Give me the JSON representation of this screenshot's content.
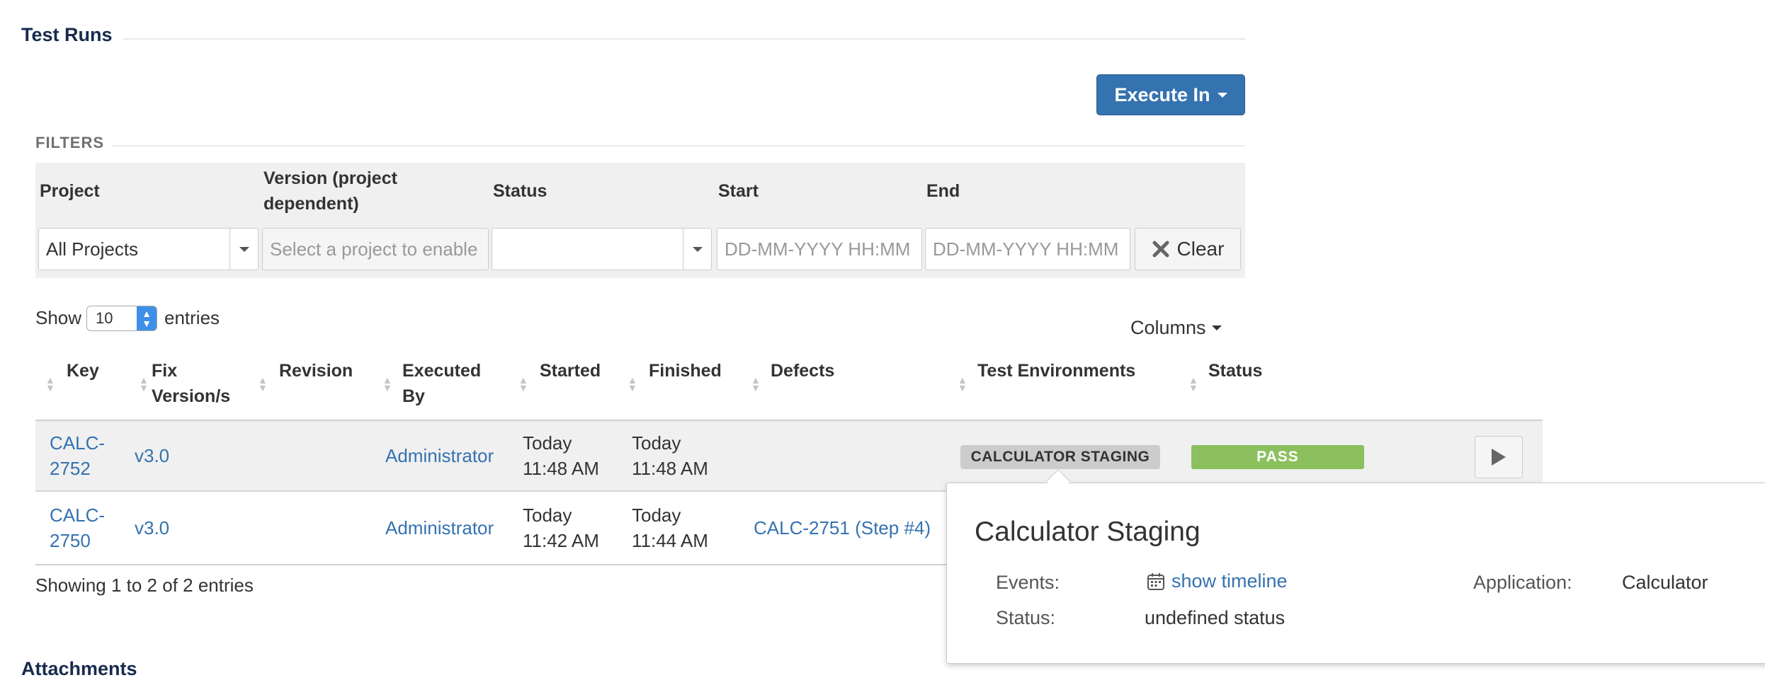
{
  "section": {
    "title": "Test Runs",
    "footer_section_title": "Attachments"
  },
  "toolbar": {
    "execute_label": "Execute In"
  },
  "filters": {
    "label": "FILTERS",
    "project_label": "Project",
    "version_label_line1": "Version (project",
    "version_label_line2": "dependent)",
    "status_label": "Status",
    "start_label": "Start",
    "end_label": "End",
    "project_value": "All Projects",
    "version_placeholder": "Select a project to enable",
    "status_value": "",
    "start_placeholder": "DD-MM-YYYY HH:MM",
    "end_placeholder": "DD-MM-YYYY HH:MM",
    "clear_label": "Clear"
  },
  "entries": {
    "show_label": "Show",
    "value": "10",
    "entries_label": "entries"
  },
  "columns_label": "Columns",
  "table": {
    "headers": {
      "key": "Key",
      "fix_versions_line1": "Fix",
      "fix_versions_line2": "Version/s",
      "revision": "Revision",
      "executed_by_line1": "Executed",
      "executed_by_line2": "By",
      "started": "Started",
      "finished": "Finished",
      "defects": "Defects",
      "test_environments": "Test Environments",
      "status": "Status"
    },
    "rows": [
      {
        "key_line1": "CALC-",
        "key_line2": "2752",
        "fix_version": "v3.0",
        "executed_by": "Administrator",
        "started_line1": "Today",
        "started_line2": "11:48 AM",
        "finished_line1": "Today",
        "finished_line2": "11:48 AM",
        "defects": "",
        "environment": "CALCULATOR STAGING",
        "status": "PASS"
      },
      {
        "key_line1": "CALC-",
        "key_line2": "2750",
        "fix_version": "v3.0",
        "executed_by": "Administrator",
        "started_line1": "Today",
        "started_line2": "11:42 AM",
        "finished_line1": "Today",
        "finished_line2": "11:44 AM",
        "defects": "CALC-2751 (Step #4)"
      }
    ],
    "footer": "Showing 1 to 2 of 2 entries"
  },
  "popup": {
    "title": "Calculator Staging",
    "events_label": "Events:",
    "events_link": "show timeline",
    "status_label": "Status:",
    "status_value": "undefined status",
    "application_label": "Application:",
    "application_value": "Calculator"
  },
  "colors": {
    "primary": "#3572b0",
    "pass": "#8cc05f",
    "environment_badge": "#cccccc"
  }
}
